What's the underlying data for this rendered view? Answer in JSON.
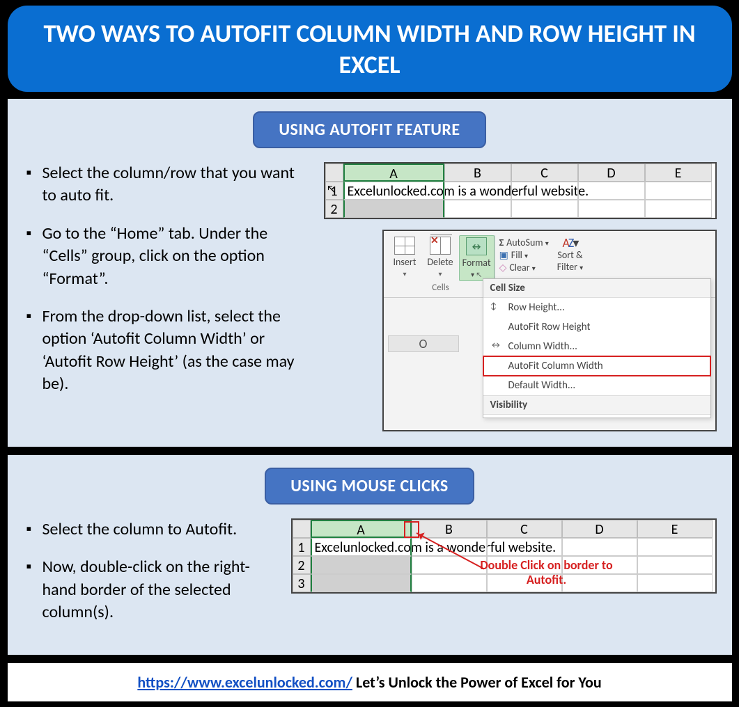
{
  "title": "TWO WAYS TO AUTOFIT COLUMN WIDTH AND ROW HEIGHT IN EXCEL",
  "section1": {
    "heading": "USING AUTOFIT FEATURE",
    "bullets": [
      "Select the column/row that you want to auto fit.",
      "Go to the “Home” tab. Under the “Cells” group, click on the option “Format”.",
      "From the drop-down list, select the option ‘Autofit Column Width’ or ‘Autofit Row Height’ (as the case may be)."
    ],
    "sheet": {
      "columns": [
        "A",
        "B",
        "C",
        "D",
        "E"
      ],
      "cell_text": "Excelunlocked.com is a wonderful website."
    },
    "ribbon": {
      "buttons": {
        "insert": "Insert",
        "delete": "Delete",
        "format": "Format"
      },
      "group_label": "Cells",
      "editing": {
        "autosum": "AutoSum",
        "fill": "Fill",
        "clear": "Clear",
        "sort": "Sort &",
        "filter": "Filter"
      },
      "dropdown_header": "Cell Size",
      "items": [
        "Row Height...",
        "AutoFit Row Height",
        "Column Width...",
        "AutoFit Column Width",
        "Default Width..."
      ],
      "footer_header": "Visibility",
      "col_letter": "O"
    }
  },
  "section2": {
    "heading": "USING MOUSE CLICKS",
    "bullets": [
      "Select the column to Autofit.",
      "Now, double-click on the right-hand border of the selected column(s)."
    ],
    "sheet": {
      "columns": [
        "A",
        "B",
        "C",
        "D",
        "E"
      ],
      "cell_text": "Excelunlocked.com is a wonderful website.",
      "rows": [
        "1",
        "2",
        "3"
      ]
    },
    "callout": "Double Click on border to Autofit."
  },
  "footer": {
    "link_text": "https://www.excelunlocked.com/",
    "rest": " Let’s Unlock the Power of Excel for You"
  }
}
